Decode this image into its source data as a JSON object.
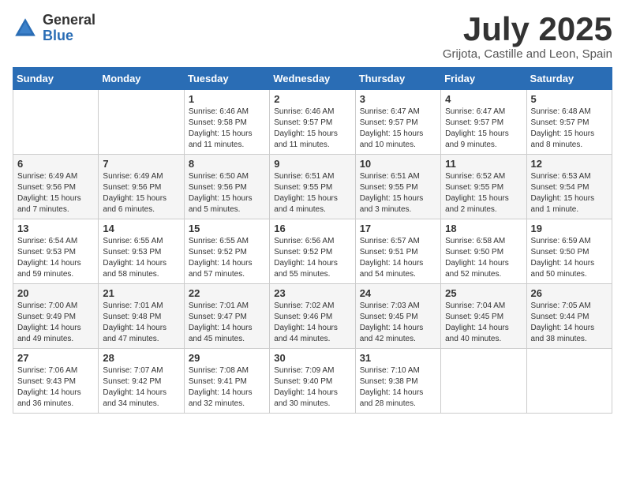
{
  "logo": {
    "general": "General",
    "blue": "Blue"
  },
  "title": "July 2025",
  "location": "Grijota, Castille and Leon, Spain",
  "weekdays": [
    "Sunday",
    "Monday",
    "Tuesday",
    "Wednesday",
    "Thursday",
    "Friday",
    "Saturday"
  ],
  "weeks": [
    [
      {
        "day": "",
        "sunrise": "",
        "sunset": "",
        "daylight": ""
      },
      {
        "day": "",
        "sunrise": "",
        "sunset": "",
        "daylight": ""
      },
      {
        "day": "1",
        "sunrise": "Sunrise: 6:46 AM",
        "sunset": "Sunset: 9:58 PM",
        "daylight": "Daylight: 15 hours and 11 minutes."
      },
      {
        "day": "2",
        "sunrise": "Sunrise: 6:46 AM",
        "sunset": "Sunset: 9:57 PM",
        "daylight": "Daylight: 15 hours and 11 minutes."
      },
      {
        "day": "3",
        "sunrise": "Sunrise: 6:47 AM",
        "sunset": "Sunset: 9:57 PM",
        "daylight": "Daylight: 15 hours and 10 minutes."
      },
      {
        "day": "4",
        "sunrise": "Sunrise: 6:47 AM",
        "sunset": "Sunset: 9:57 PM",
        "daylight": "Daylight: 15 hours and 9 minutes."
      },
      {
        "day": "5",
        "sunrise": "Sunrise: 6:48 AM",
        "sunset": "Sunset: 9:57 PM",
        "daylight": "Daylight: 15 hours and 8 minutes."
      }
    ],
    [
      {
        "day": "6",
        "sunrise": "Sunrise: 6:49 AM",
        "sunset": "Sunset: 9:56 PM",
        "daylight": "Daylight: 15 hours and 7 minutes."
      },
      {
        "day": "7",
        "sunrise": "Sunrise: 6:49 AM",
        "sunset": "Sunset: 9:56 PM",
        "daylight": "Daylight: 15 hours and 6 minutes."
      },
      {
        "day": "8",
        "sunrise": "Sunrise: 6:50 AM",
        "sunset": "Sunset: 9:56 PM",
        "daylight": "Daylight: 15 hours and 5 minutes."
      },
      {
        "day": "9",
        "sunrise": "Sunrise: 6:51 AM",
        "sunset": "Sunset: 9:55 PM",
        "daylight": "Daylight: 15 hours and 4 minutes."
      },
      {
        "day": "10",
        "sunrise": "Sunrise: 6:51 AM",
        "sunset": "Sunset: 9:55 PM",
        "daylight": "Daylight: 15 hours and 3 minutes."
      },
      {
        "day": "11",
        "sunrise": "Sunrise: 6:52 AM",
        "sunset": "Sunset: 9:55 PM",
        "daylight": "Daylight: 15 hours and 2 minutes."
      },
      {
        "day": "12",
        "sunrise": "Sunrise: 6:53 AM",
        "sunset": "Sunset: 9:54 PM",
        "daylight": "Daylight: 15 hours and 1 minute."
      }
    ],
    [
      {
        "day": "13",
        "sunrise": "Sunrise: 6:54 AM",
        "sunset": "Sunset: 9:53 PM",
        "daylight": "Daylight: 14 hours and 59 minutes."
      },
      {
        "day": "14",
        "sunrise": "Sunrise: 6:55 AM",
        "sunset": "Sunset: 9:53 PM",
        "daylight": "Daylight: 14 hours and 58 minutes."
      },
      {
        "day": "15",
        "sunrise": "Sunrise: 6:55 AM",
        "sunset": "Sunset: 9:52 PM",
        "daylight": "Daylight: 14 hours and 57 minutes."
      },
      {
        "day": "16",
        "sunrise": "Sunrise: 6:56 AM",
        "sunset": "Sunset: 9:52 PM",
        "daylight": "Daylight: 14 hours and 55 minutes."
      },
      {
        "day": "17",
        "sunrise": "Sunrise: 6:57 AM",
        "sunset": "Sunset: 9:51 PM",
        "daylight": "Daylight: 14 hours and 54 minutes."
      },
      {
        "day": "18",
        "sunrise": "Sunrise: 6:58 AM",
        "sunset": "Sunset: 9:50 PM",
        "daylight": "Daylight: 14 hours and 52 minutes."
      },
      {
        "day": "19",
        "sunrise": "Sunrise: 6:59 AM",
        "sunset": "Sunset: 9:50 PM",
        "daylight": "Daylight: 14 hours and 50 minutes."
      }
    ],
    [
      {
        "day": "20",
        "sunrise": "Sunrise: 7:00 AM",
        "sunset": "Sunset: 9:49 PM",
        "daylight": "Daylight: 14 hours and 49 minutes."
      },
      {
        "day": "21",
        "sunrise": "Sunrise: 7:01 AM",
        "sunset": "Sunset: 9:48 PM",
        "daylight": "Daylight: 14 hours and 47 minutes."
      },
      {
        "day": "22",
        "sunrise": "Sunrise: 7:01 AM",
        "sunset": "Sunset: 9:47 PM",
        "daylight": "Daylight: 14 hours and 45 minutes."
      },
      {
        "day": "23",
        "sunrise": "Sunrise: 7:02 AM",
        "sunset": "Sunset: 9:46 PM",
        "daylight": "Daylight: 14 hours and 44 minutes."
      },
      {
        "day": "24",
        "sunrise": "Sunrise: 7:03 AM",
        "sunset": "Sunset: 9:45 PM",
        "daylight": "Daylight: 14 hours and 42 minutes."
      },
      {
        "day": "25",
        "sunrise": "Sunrise: 7:04 AM",
        "sunset": "Sunset: 9:45 PM",
        "daylight": "Daylight: 14 hours and 40 minutes."
      },
      {
        "day": "26",
        "sunrise": "Sunrise: 7:05 AM",
        "sunset": "Sunset: 9:44 PM",
        "daylight": "Daylight: 14 hours and 38 minutes."
      }
    ],
    [
      {
        "day": "27",
        "sunrise": "Sunrise: 7:06 AM",
        "sunset": "Sunset: 9:43 PM",
        "daylight": "Daylight: 14 hours and 36 minutes."
      },
      {
        "day": "28",
        "sunrise": "Sunrise: 7:07 AM",
        "sunset": "Sunset: 9:42 PM",
        "daylight": "Daylight: 14 hours and 34 minutes."
      },
      {
        "day": "29",
        "sunrise": "Sunrise: 7:08 AM",
        "sunset": "Sunset: 9:41 PM",
        "daylight": "Daylight: 14 hours and 32 minutes."
      },
      {
        "day": "30",
        "sunrise": "Sunrise: 7:09 AM",
        "sunset": "Sunset: 9:40 PM",
        "daylight": "Daylight: 14 hours and 30 minutes."
      },
      {
        "day": "31",
        "sunrise": "Sunrise: 7:10 AM",
        "sunset": "Sunset: 9:38 PM",
        "daylight": "Daylight: 14 hours and 28 minutes."
      },
      {
        "day": "",
        "sunrise": "",
        "sunset": "",
        "daylight": ""
      },
      {
        "day": "",
        "sunrise": "",
        "sunset": "",
        "daylight": ""
      }
    ]
  ]
}
